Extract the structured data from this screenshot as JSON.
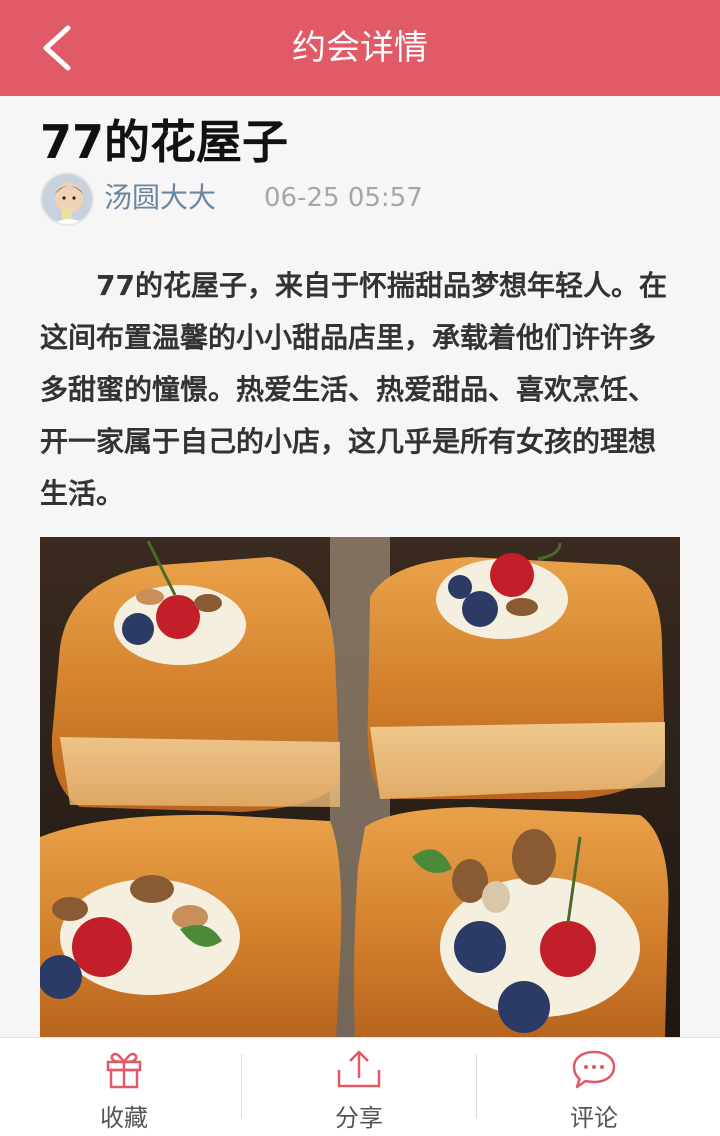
{
  "header": {
    "title": "约会详情",
    "back_icon": "chevron-left-icon",
    "background_color": "#e05a68"
  },
  "post": {
    "title": "77的花屋子",
    "author": "汤圆大大",
    "time": "06-25 05:57",
    "body": "77的花屋子，来自于怀揣甜品梦想年轻人。在这间布置温馨的小小甜品店里，承载着他们许许多多甜蜜的憧憬。热爱生活、热爱甜品、喜欢烹饪、开一家属于自己的小店，这几乎是所有女孩的理想生活。"
  },
  "bottom_bar": {
    "accent_color": "#e05a68",
    "items": [
      {
        "label": "收藏",
        "icon": "gift-icon"
      },
      {
        "label": "分享",
        "icon": "share-icon"
      },
      {
        "label": "评论",
        "icon": "comment-icon"
      }
    ]
  }
}
